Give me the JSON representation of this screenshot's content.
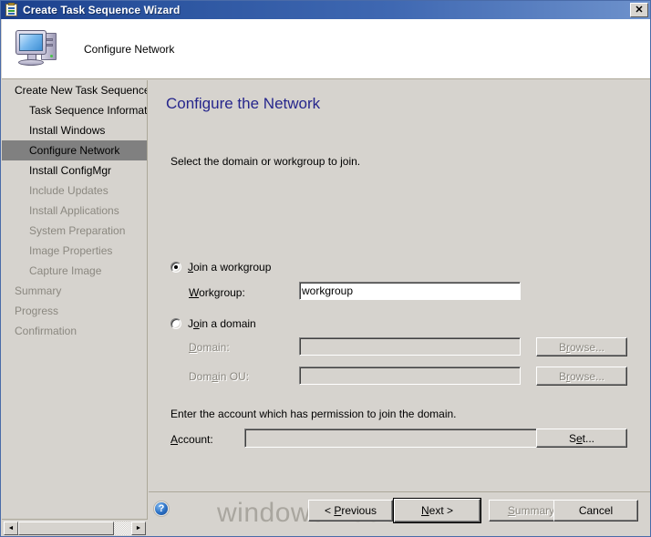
{
  "window": {
    "title": "Create Task Sequence Wizard",
    "title_icon": "clipboard-checklist-icon",
    "close_label": "✕",
    "header_title": "Configure Network",
    "header_icon": "computer-icon",
    "colors": {
      "title_gradient_start": "#1b3f8b",
      "title_gradient_end": "#6e92cc",
      "dialog_face": "#d6d3ce",
      "selection": "#808080",
      "page_title": "#26268c",
      "disabled_text": "#8b8880",
      "watermark": "#a9a69f"
    }
  },
  "sidebar": {
    "items": [
      {
        "label": "Create New Task Sequence",
        "level": 0,
        "state": "done"
      },
      {
        "label": "Task Sequence Information",
        "level": 1,
        "state": "done"
      },
      {
        "label": "Install Windows",
        "level": 1,
        "state": "done"
      },
      {
        "label": "Configure Network",
        "level": 1,
        "state": "selected"
      },
      {
        "label": "Install ConfigMgr",
        "level": 1,
        "state": "done"
      },
      {
        "label": "Include Updates",
        "level": 1,
        "state": "pending"
      },
      {
        "label": "Install Applications",
        "level": 1,
        "state": "pending"
      },
      {
        "label": "System Preparation",
        "level": 1,
        "state": "pending"
      },
      {
        "label": "Image Properties",
        "level": 1,
        "state": "pending"
      },
      {
        "label": "Capture Image",
        "level": 1,
        "state": "pending"
      },
      {
        "label": "Summary",
        "level": 0,
        "state": "pending"
      },
      {
        "label": "Progress",
        "level": 0,
        "state": "pending"
      },
      {
        "label": "Confirmation",
        "level": 0,
        "state": "pending"
      }
    ],
    "scrollbar": {
      "left_arrow": "◄",
      "right_arrow": "►"
    }
  },
  "main": {
    "page_title": "Configure the Network",
    "intro_text": "Select the domain or workgroup to join.",
    "workgroup_option": {
      "label_prefix": "",
      "label_accel": "J",
      "label_suffix": "oin a workgroup",
      "checked": true
    },
    "workgroup_field": {
      "label_accel": "W",
      "label_suffix": "orkgroup:",
      "value": "workgroup",
      "enabled": true
    },
    "domain_option": {
      "label_prefix": "J",
      "label_accel": "o",
      "label_suffix": "in a domain",
      "checked": false
    },
    "domain_field": {
      "label_prefix": "",
      "label_accel": "D",
      "label_suffix": "omain:",
      "value": "",
      "enabled": false,
      "browse_prefix": "B",
      "browse_accel": "r",
      "browse_suffix": "owse...",
      "browse_enabled": false
    },
    "domain_ou_field": {
      "label_prefix": "Dom",
      "label_accel": "a",
      "label_suffix": "in OU:",
      "value": "",
      "enabled": false,
      "browse_prefix": "B",
      "browse_accel": "r",
      "browse_suffix": "owse...",
      "browse_enabled": false
    },
    "account_text": "Enter the account which has permission to join the domain.",
    "account_field": {
      "label_accel": "A",
      "label_suffix": "ccount:",
      "value": "",
      "enabled": true,
      "set_prefix": "S",
      "set_accel": "e",
      "set_suffix": "t...",
      "set_enabled": true
    }
  },
  "bottombar": {
    "help_icon": "help-question-icon",
    "help_glyph": "?",
    "watermark": "windows-noob.com",
    "buttons": {
      "previous": {
        "prefix": "< ",
        "accel": "P",
        "suffix": "revious",
        "enabled": true,
        "default": false
      },
      "next": {
        "prefix": "",
        "accel": "N",
        "suffix": "ext >",
        "enabled": true,
        "default": true
      },
      "summary": {
        "prefix": "",
        "accel": "S",
        "suffix": "ummary",
        "enabled": false,
        "default": false
      },
      "cancel": {
        "prefix": "Cancel",
        "accel": "",
        "suffix": "",
        "enabled": true,
        "default": false
      }
    }
  }
}
